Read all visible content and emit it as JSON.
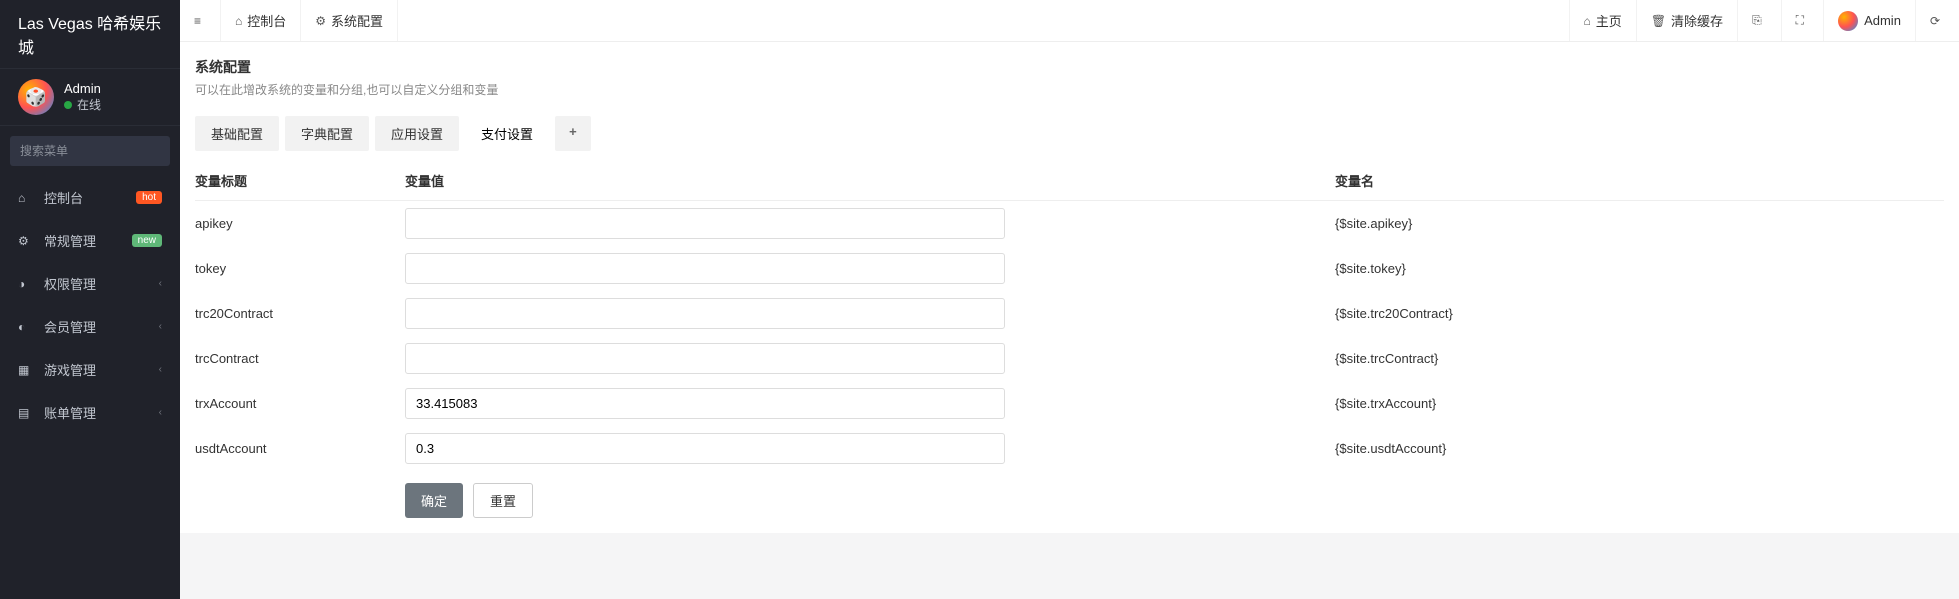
{
  "brand": "Las Vegas 哈希娱乐城",
  "user": {
    "name": "Admin",
    "status": "在线"
  },
  "search": {
    "placeholder": "搜索菜单"
  },
  "nav": [
    {
      "icon": "dashboard-icon",
      "glyph": "⌂",
      "label": "控制台",
      "badge": "hot",
      "badgeClass": "badge-hot",
      "chevron": ""
    },
    {
      "icon": "gear-icon",
      "glyph": "⚙",
      "label": "常规管理",
      "badge": "new",
      "badgeClass": "badge-new",
      "chevron": ""
    },
    {
      "icon": "lock-icon",
      "glyph": "◑",
      "label": "权限管理",
      "badge": "",
      "badgeClass": "",
      "chevron": "‹"
    },
    {
      "icon": "user-icon",
      "glyph": "◐",
      "label": "会员管理",
      "badge": "",
      "badgeClass": "",
      "chevron": "‹"
    },
    {
      "icon": "grid-icon",
      "glyph": "▦",
      "label": "游戏管理",
      "badge": "",
      "badgeClass": "",
      "chevron": "‹"
    },
    {
      "icon": "list-icon",
      "glyph": "▤",
      "label": "账单管理",
      "badge": "",
      "badgeClass": "",
      "chevron": "‹"
    }
  ],
  "topLeft": [
    {
      "icon": "menu-icon",
      "glyph": "≡",
      "label": ""
    },
    {
      "icon": "dashboard-icon",
      "glyph": "⌂",
      "label": "控制台"
    },
    {
      "icon": "gear-icon",
      "glyph": "⚙",
      "label": "系统配置",
      "active": true
    }
  ],
  "topRight": [
    {
      "icon": "home-icon",
      "glyph": "⌂",
      "label": "主页"
    },
    {
      "icon": "trash-icon",
      "glyph": "🗑",
      "label": "清除缓存"
    },
    {
      "icon": "book-icon",
      "glyph": "⎘",
      "label": ""
    },
    {
      "icon": "expand-icon",
      "glyph": "⛶",
      "label": ""
    },
    {
      "icon": "avatar-icon",
      "glyph": "",
      "label": "Admin",
      "avatar": true
    },
    {
      "icon": "more-icon",
      "glyph": "⟳",
      "label": ""
    }
  ],
  "panel": {
    "title": "系统配置",
    "sub": "可以在此增改系统的变量和分组,也可以自定义分组和变量"
  },
  "tabs": [
    "基础配置",
    "字典配置",
    "应用设置",
    "支付设置"
  ],
  "activeTabIndex": 3,
  "columns": {
    "c0": "变量标题",
    "c1": "变量值",
    "c2": "变量名"
  },
  "rows": [
    {
      "title": "apikey",
      "value": "",
      "name": "{$site.apikey}"
    },
    {
      "title": "tokey",
      "value": "",
      "name": "{$site.tokey}"
    },
    {
      "title": "trc20Contract",
      "value": "",
      "name": "{$site.trc20Contract}"
    },
    {
      "title": "trcContract",
      "value": "",
      "name": "{$site.trcContract}"
    },
    {
      "title": "trxAccount",
      "value": "33.415083",
      "name": "{$site.trxAccount}"
    },
    {
      "title": "usdtAccount",
      "value": "0.3",
      "name": "{$site.usdtAccount}"
    }
  ],
  "buttons": {
    "ok": "确定",
    "reset": "重置"
  }
}
